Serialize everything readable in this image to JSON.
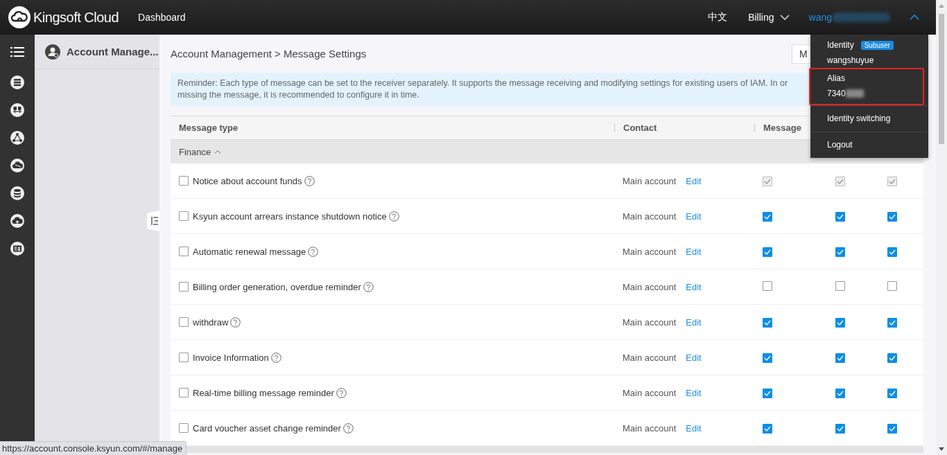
{
  "topbar": {
    "brand": "Kingsoft Cloud",
    "nav": [
      "Dashboard"
    ],
    "language": "中文",
    "billing": "Billing",
    "user": "wang"
  },
  "sidebar": {
    "title": "Account Manage..."
  },
  "breadcrumb": "Account Management > Message Settings",
  "top_button": "M",
  "reminder": [
    "Reminder: Each type of message can be set to the receiver separately. It supports the message receiving and modifying settings for existing users of IAM. In or",
    "missing the message, it is recommended to configure it in time."
  ],
  "table": {
    "columns": [
      "Message type",
      "Contact",
      "Message"
    ],
    "group": {
      "label": "Finance",
      "expanded": true
    },
    "rows": [
      {
        "name": "Notice about account funds",
        "selected": false,
        "contact": "Main account",
        "action": "Edit",
        "disabled": true,
        "checks": [
          true,
          true,
          true
        ]
      },
      {
        "name": "Ksyun account arrears instance shutdown notice",
        "selected": false,
        "contact": "Main account",
        "action": "Edit",
        "disabled": false,
        "checks": [
          true,
          true,
          true
        ]
      },
      {
        "name": "Automatic renewal message",
        "selected": false,
        "contact": "Main account",
        "action": "Edit",
        "disabled": false,
        "checks": [
          true,
          true,
          true
        ]
      },
      {
        "name": "Billing order generation, overdue reminder",
        "selected": false,
        "contact": "Main account",
        "action": "Edit",
        "disabled": false,
        "checks": [
          false,
          false,
          false
        ]
      },
      {
        "name": "withdraw",
        "selected": false,
        "contact": "Main account",
        "action": "Edit",
        "disabled": false,
        "checks": [
          true,
          true,
          true
        ]
      },
      {
        "name": "Invoice Information",
        "selected": false,
        "contact": "Main account",
        "action": "Edit",
        "disabled": false,
        "checks": [
          true,
          true,
          true
        ]
      },
      {
        "name": "Real-time billing message reminder",
        "selected": false,
        "contact": "Main account",
        "action": "Edit",
        "disabled": false,
        "checks": [
          true,
          true,
          true
        ]
      },
      {
        "name": "Card voucher asset change reminder",
        "selected": false,
        "contact": "Main account",
        "action": "Edit",
        "disabled": false,
        "checks": [
          true,
          true,
          true
        ]
      }
    ]
  },
  "user_menu": {
    "identity_label": "Identity",
    "badge": "Subuser",
    "identity": "wangshuyue",
    "alias_label": "Alias",
    "alias": "7340",
    "items": [
      "Identity switching",
      "Logout"
    ]
  },
  "status_url": "https://account.console.ksyun.com/#/manage"
}
